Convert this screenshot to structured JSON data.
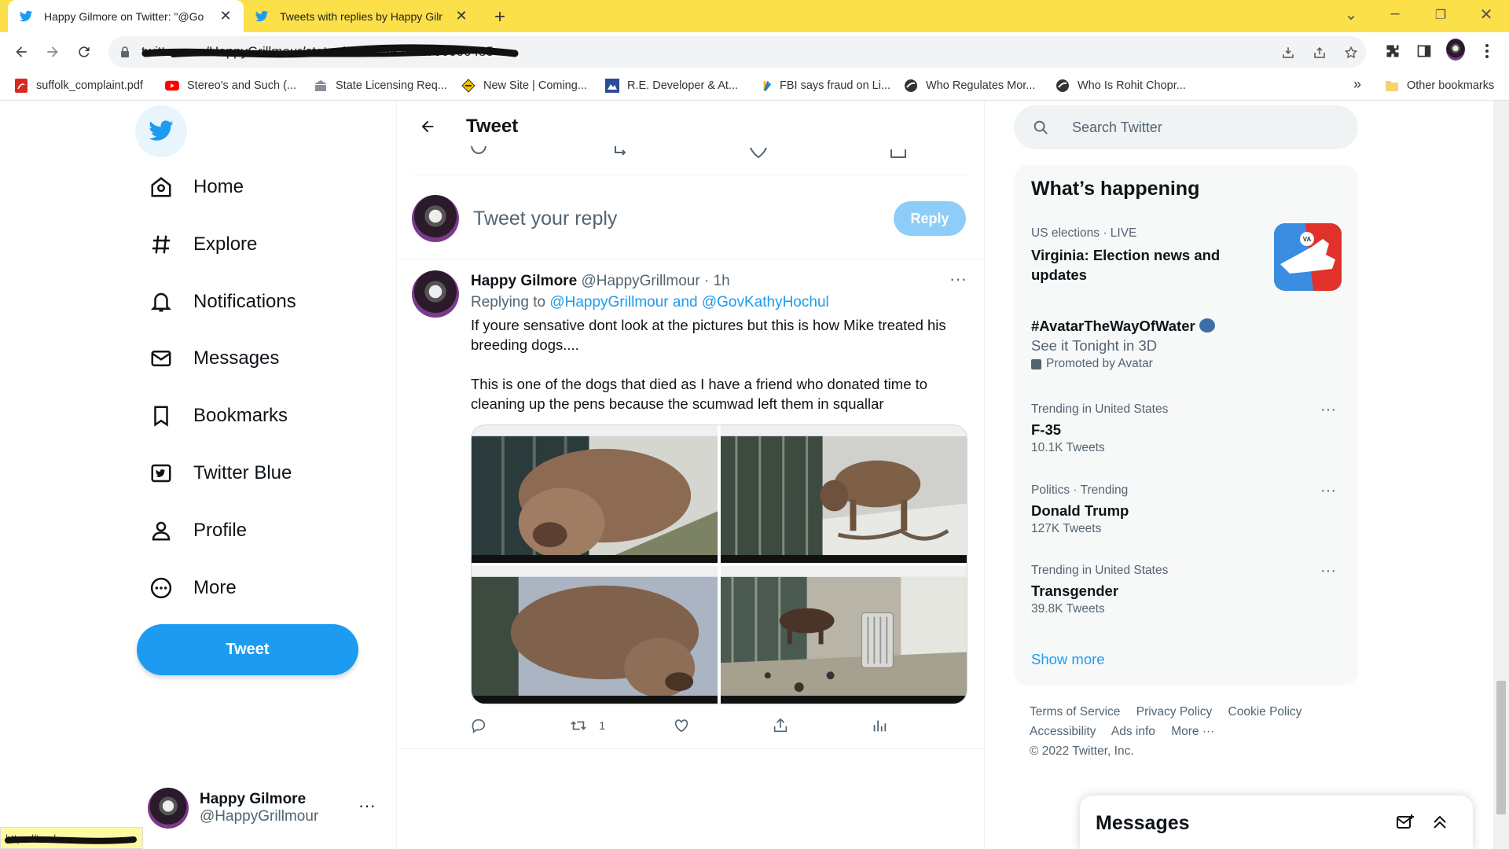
{
  "browser": {
    "tabs": [
      {
        "title": "Happy Gilmore on Twitter: \"@Go",
        "close": "✕"
      },
      {
        "title": "Tweets with replies by Happy Gilr",
        "close": "✕"
      }
    ],
    "new_tab": "+",
    "url": "twitter.com/HappyGrillmour/status/16024895846790000485",
    "bookmarks": [
      "suffolk_complaint.pdf",
      "Stereo's and Such (...",
      "State Licensing Req...",
      "New Site | Coming...",
      "R.E. Developer & At...",
      "FBI says fraud on Li...",
      "Who Regulates Mor...",
      "Who Is Rohit Chopr..."
    ],
    "bookmarks_overflow": "»",
    "other_bookmarks": "Other bookmarks",
    "status_url": "https://t.co/..."
  },
  "nav": {
    "items": [
      {
        "label": "Home",
        "icon": "home-icon"
      },
      {
        "label": "Explore",
        "icon": "hashtag-icon"
      },
      {
        "label": "Notifications",
        "icon": "bell-icon"
      },
      {
        "label": "Messages",
        "icon": "envelope-icon"
      },
      {
        "label": "Bookmarks",
        "icon": "bookmark-icon"
      },
      {
        "label": "Twitter Blue",
        "icon": "twitter-blue-icon"
      },
      {
        "label": "Profile",
        "icon": "person-icon"
      },
      {
        "label": "More",
        "icon": "more-circle-icon"
      }
    ],
    "tweet_button": "Tweet"
  },
  "account": {
    "name": "Happy Gilmore",
    "handle": "@HappyGrillmour",
    "more": "···"
  },
  "main": {
    "title": "Tweet",
    "reply_placeholder": "Tweet your reply",
    "reply_button": "Reply",
    "tweet": {
      "name": "Happy Gilmore",
      "handle": "@HappyGrillmour",
      "time": "· 1h",
      "replying_prefix": "Replying to",
      "replying_to": "@HappyGrillmour and @GovKathyHochul",
      "text_p1": "If youre sensative dont look at the pictures but this is how Mike treated his breeding dogs....",
      "text_p2": "This is one of the dogs that died as I have a friend who donated time to cleaning up the pens because the scumwad left them in squallar",
      "retweet_count": "1",
      "more": "···"
    }
  },
  "sidebar": {
    "search_placeholder": "Search Twitter",
    "trends_title": "What’s happening",
    "trends": [
      {
        "context": "US elections · LIVE",
        "title": "Virginia: Election news and updates",
        "count": ""
      },
      {
        "context": "",
        "title": "#AvatarTheWayOfWater",
        "subtitle": "See it Tonight in 3D",
        "promoted": "Promoted by Avatar"
      },
      {
        "context": "Trending in United States",
        "title": "F-35",
        "count": "10.1K Tweets"
      },
      {
        "context": "Politics · Trending",
        "title": "Donald Trump",
        "count": "127K Tweets"
      },
      {
        "context": "Trending in United States",
        "title": "Transgender",
        "count": "39.8K Tweets"
      }
    ],
    "trend_image_badge": "VA",
    "show_more": "Show more",
    "footer": {
      "links": [
        "Terms of Service",
        "Privacy Policy",
        "Cookie Policy",
        "Accessibility",
        "Ads info",
        "More ···"
      ],
      "copyright": "© 2022 Twitter, Inc."
    }
  },
  "messages_dock": {
    "title": "Messages"
  },
  "colors": {
    "accent": "#1d9bf0",
    "tabbar": "#fbe049",
    "secondary_text": "#536471"
  }
}
